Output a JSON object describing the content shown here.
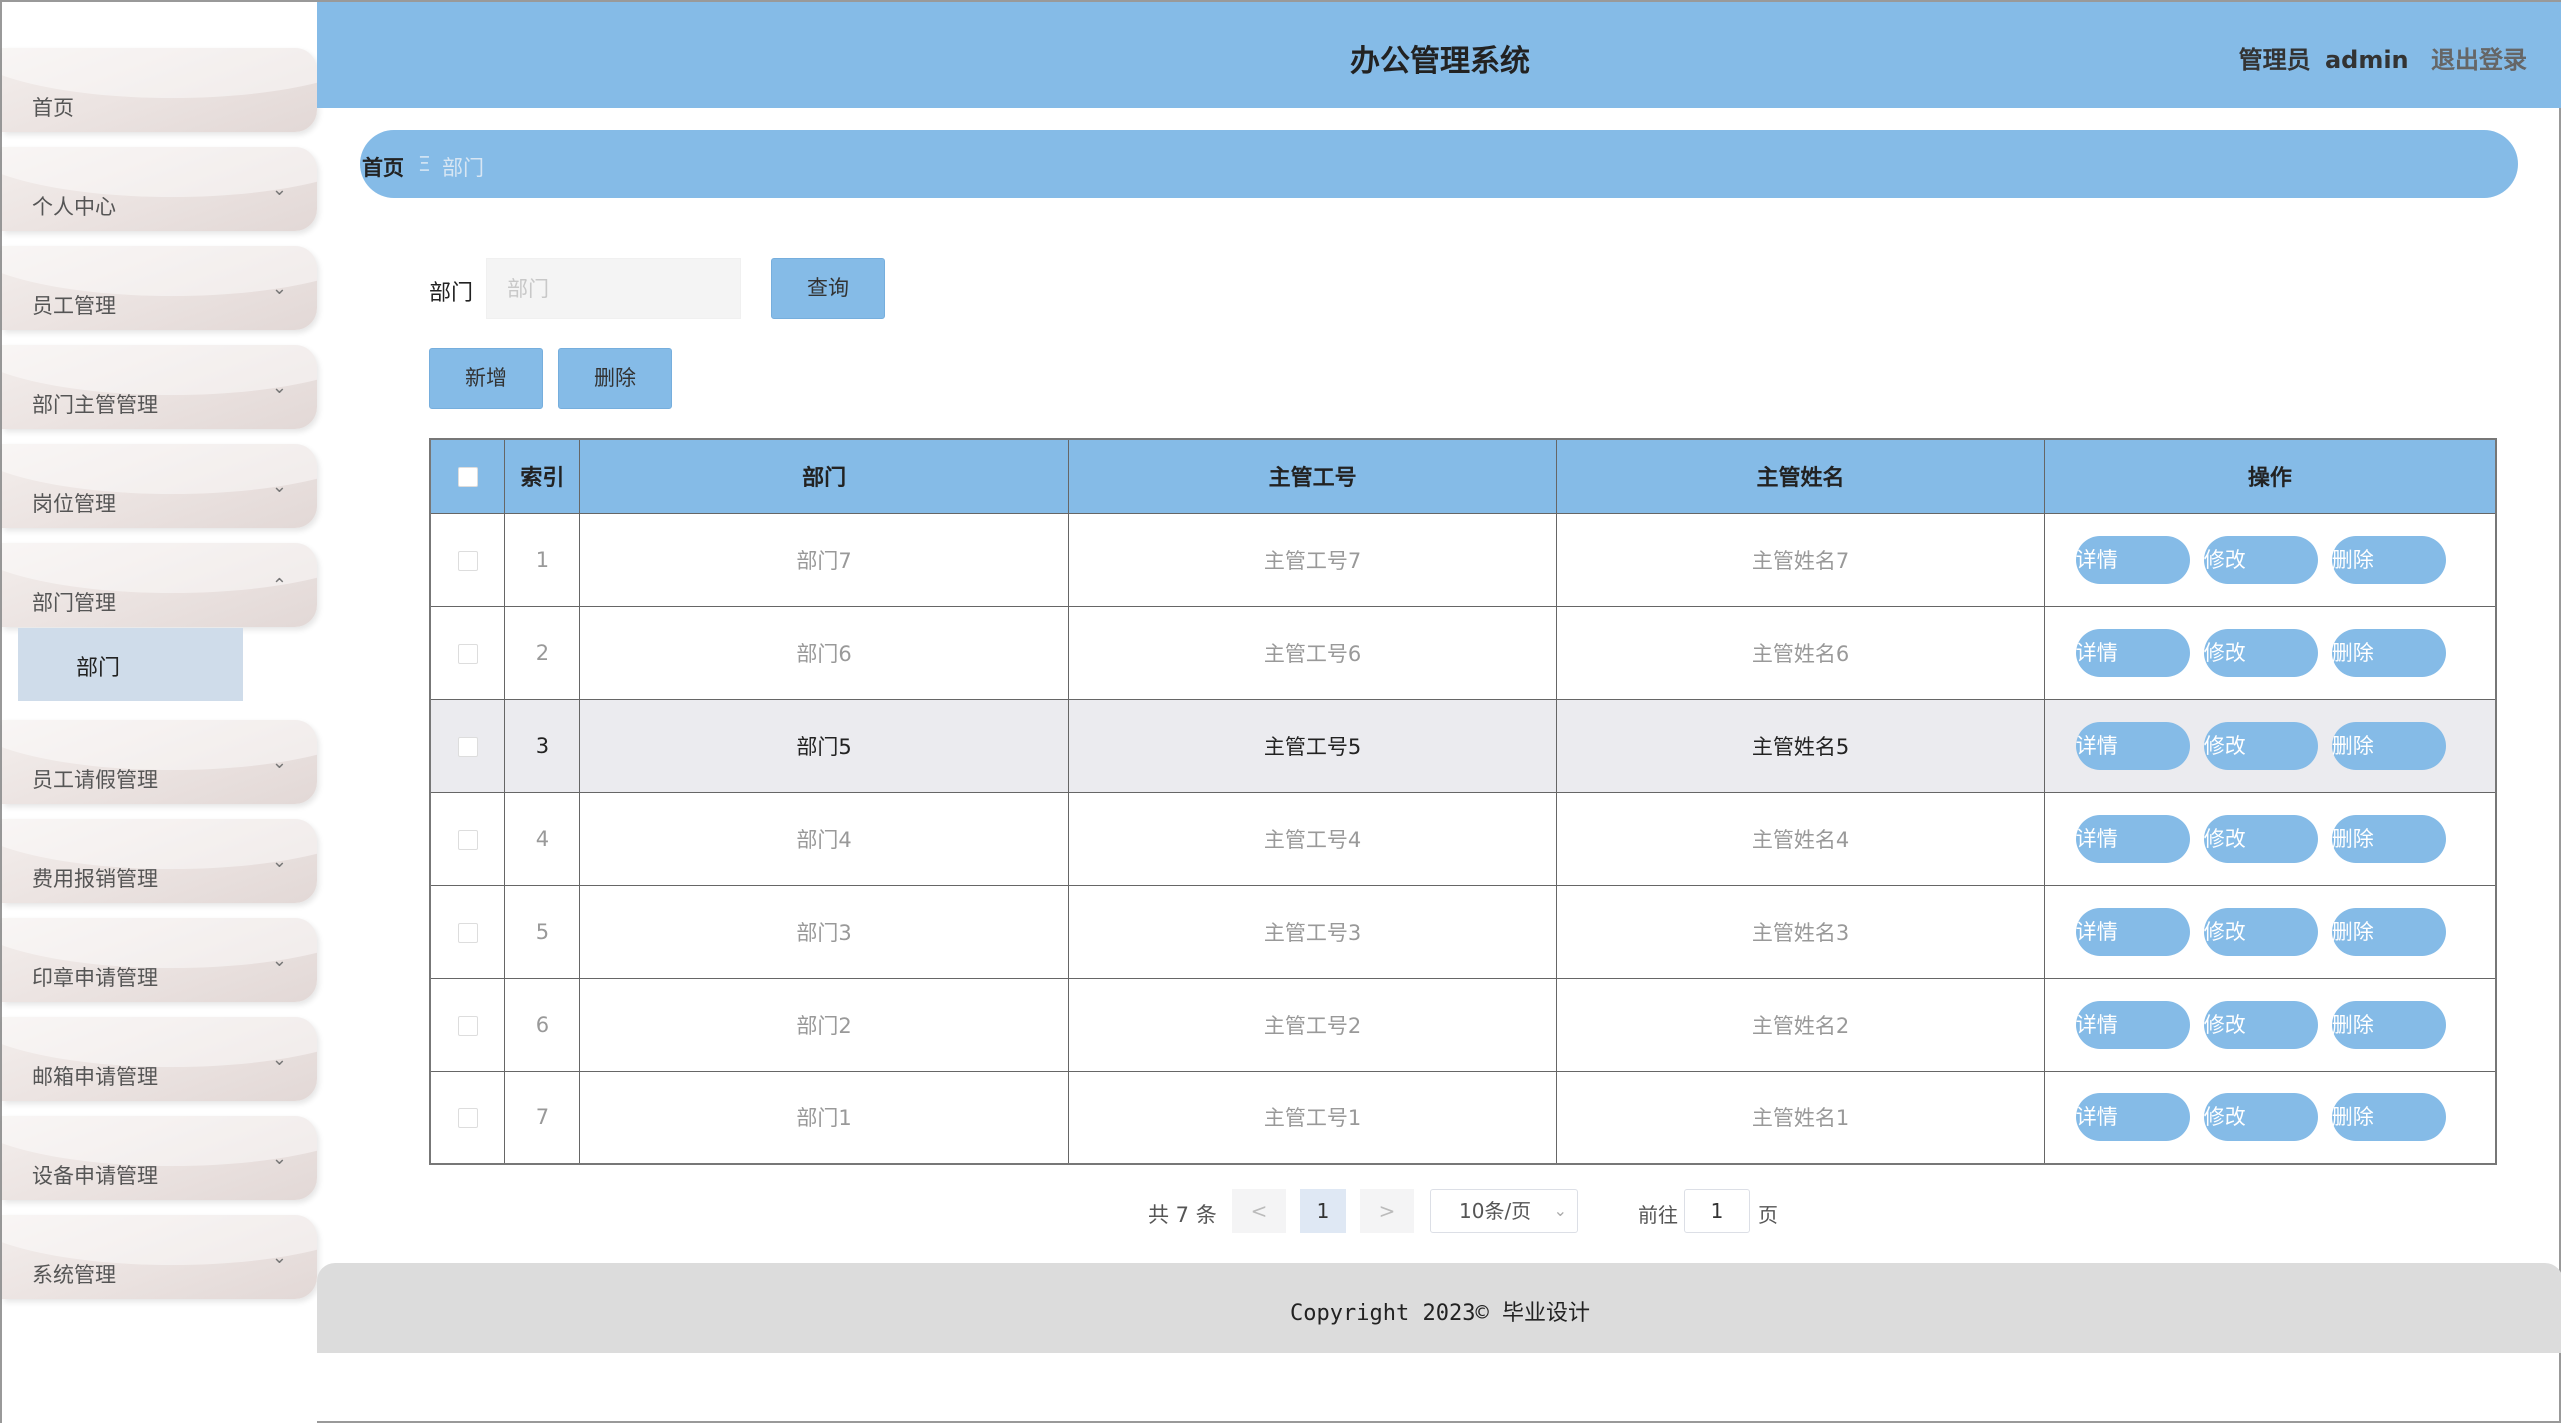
{
  "app": {
    "title": "办公管理系统"
  },
  "user": {
    "role": "管理员",
    "name": "admin",
    "logout_label": "退出登录"
  },
  "sidebar": {
    "items": [
      {
        "label": "首页",
        "arrow": ""
      },
      {
        "label": "个人中心",
        "arrow": "⌄"
      },
      {
        "label": "员工管理",
        "arrow": "⌄"
      },
      {
        "label": "部门主管管理",
        "arrow": "⌄"
      },
      {
        "label": "岗位管理",
        "arrow": "⌄"
      },
      {
        "label": "部门管理",
        "arrow": "⌃"
      },
      {
        "label": "员工请假管理",
        "arrow": "⌄"
      },
      {
        "label": "费用报销管理",
        "arrow": "⌄"
      },
      {
        "label": "印章申请管理",
        "arrow": "⌄"
      },
      {
        "label": "邮箱申请管理",
        "arrow": "⌄"
      },
      {
        "label": "设备申请管理",
        "arrow": "⌄"
      },
      {
        "label": "系统管理",
        "arrow": "⌄"
      }
    ],
    "active_submenu": {
      "label": "部门"
    }
  },
  "breadcrumb": {
    "home": "首页",
    "separator": "Ξ",
    "current": "部门"
  },
  "search": {
    "label": "部门",
    "placeholder": "部门",
    "query_button": "查询"
  },
  "actions": {
    "add_button": "新增",
    "delete_button": "删除"
  },
  "table": {
    "headers": {
      "index": "索引",
      "dept": "部门",
      "manager_no": "主管工号",
      "manager_name": "主管姓名",
      "ops": "操作"
    },
    "rows": [
      {
        "index": "1",
        "dept": "部门7",
        "manager_no": "主管工号7",
        "manager_name": "主管姓名7"
      },
      {
        "index": "2",
        "dept": "部门6",
        "manager_no": "主管工号6",
        "manager_name": "主管姓名6"
      },
      {
        "index": "3",
        "dept": "部门5",
        "manager_no": "主管工号5",
        "manager_name": "主管姓名5"
      },
      {
        "index": "4",
        "dept": "部门4",
        "manager_no": "主管工号4",
        "manager_name": "主管姓名4"
      },
      {
        "index": "5",
        "dept": "部门3",
        "manager_no": "主管工号3",
        "manager_name": "主管姓名3"
      },
      {
        "index": "6",
        "dept": "部门2",
        "manager_no": "主管工号2",
        "manager_name": "主管姓名2"
      },
      {
        "index": "7",
        "dept": "部门1",
        "manager_no": "主管工号1",
        "manager_name": "主管姓名1"
      }
    ],
    "row_actions": {
      "detail": "详情",
      "edit": "修改",
      "delete": "删除"
    }
  },
  "pagination": {
    "total_text": "共 7 条",
    "prev": "<",
    "current_page": "1",
    "next": ">",
    "page_size": "10条/页",
    "goto_label": "前往",
    "goto_value": "1",
    "page_unit": "页"
  },
  "footer": {
    "text": "Copyright 2023© 毕业设计"
  },
  "colors": {
    "primary": "#85bbe7",
    "footer_bg": "#dcdcdc",
    "row_highlight": "#ebebef",
    "submenu_active": "#cfdcea"
  }
}
